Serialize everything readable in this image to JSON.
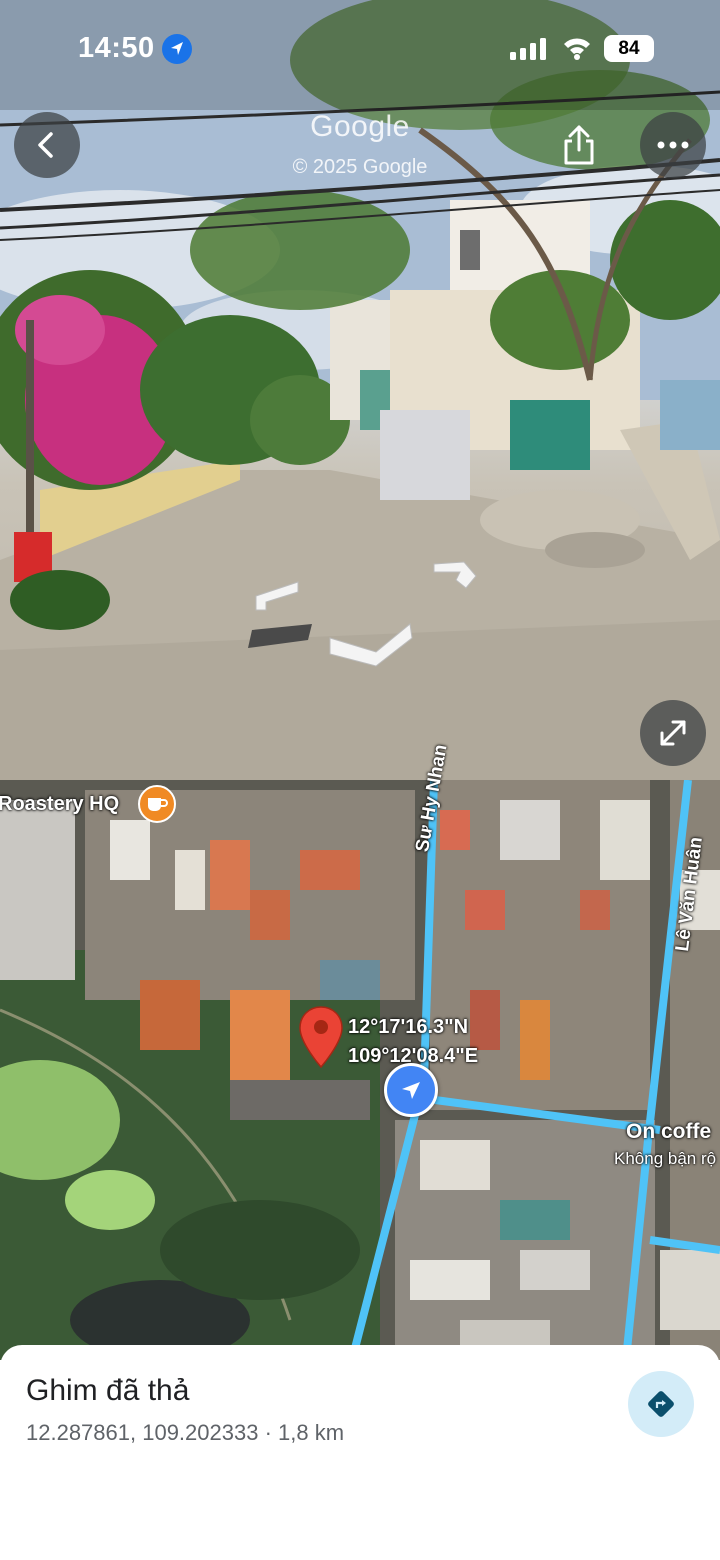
{
  "status_bar": {
    "time": "14:50",
    "battery": "84"
  },
  "street_view": {
    "watermark": "Google",
    "copyright": "© 2025 Google"
  },
  "map": {
    "roads": [
      "Sư Hy Nhan",
      "Lê Văn Huân"
    ],
    "pois": [
      {
        "name": "Roastery HQ",
        "icon": "coffee-cup-icon"
      },
      {
        "name": "On coffe",
        "subtitle": "Không bận rộ"
      }
    ],
    "pin_coords": {
      "lat": "12°17'16.3\"N",
      "lng": "109°12'08.4\"E"
    }
  },
  "place": {
    "title": "Ghim đã thả",
    "subtitle": "12.287861, 109.202333 · 1,8 km"
  },
  "colors": {
    "accent": "#1a73e8",
    "pin": "#ea4335",
    "road": "#4fc3f7",
    "dir_bg": "#d3ecf8"
  }
}
